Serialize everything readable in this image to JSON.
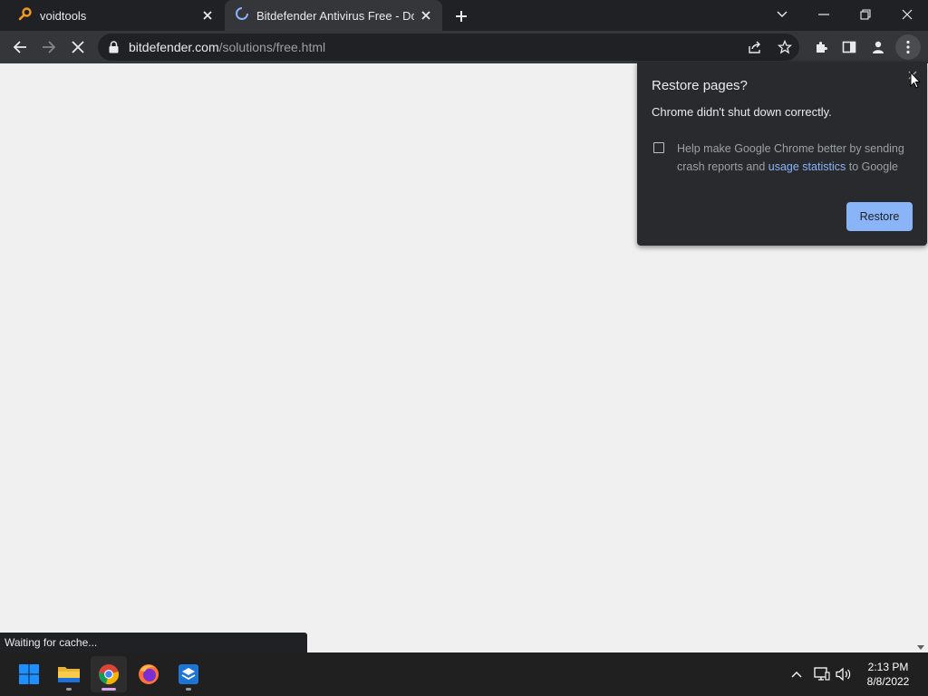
{
  "browser": {
    "tabs": [
      {
        "title": "voidtools",
        "icon": "voidtools-search-icon",
        "active": false
      },
      {
        "title": "Bitdefender Antivirus Free - Dow",
        "icon": "loading-spinner-icon",
        "active": true
      }
    ],
    "address": {
      "domain": "bitdefender.com",
      "path": "/solutions/free.html"
    },
    "status_text": "Waiting for cache..."
  },
  "restore_bubble": {
    "title": "Restore pages?",
    "message": "Chrome didn't shut down correctly.",
    "checkbox_text_before": "Help make Google Chrome better by sending crash reports and",
    "checkbox_link": "usage statistics",
    "checkbox_text_after": "to Google",
    "checkbox_checked": false,
    "restore_label": "Restore"
  },
  "taskbar": {
    "apps": [
      "start-icon",
      "file-explorer-icon",
      "chrome-icon",
      "firefox-icon",
      "installer-icon"
    ],
    "time": "2:13 PM",
    "date": "8/8/2022"
  },
  "colors": {
    "accent": "#8ab4f8",
    "tabstrip": "#202124",
    "toolbar": "#35363a",
    "page_background": "#f0f0f0"
  }
}
